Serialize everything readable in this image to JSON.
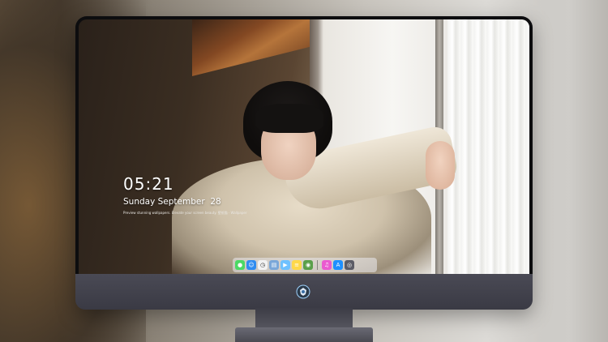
{
  "lockscreen": {
    "time": "05:21",
    "date": "Sunday September  28",
    "tagline": "Preview stunning wallpapers. Elevate your screen beauty. 壁纸猫 · Wallpaper"
  },
  "dock": {
    "icons": [
      {
        "name": "messages-icon",
        "color": "#4cd964",
        "glyph": "●"
      },
      {
        "name": "finder-icon",
        "color": "#2f8cf0",
        "glyph": "☺"
      },
      {
        "name": "clock-icon",
        "color": "#f2f2f2",
        "glyph": "◷"
      },
      {
        "name": "preview-icon",
        "color": "#7aa7d9",
        "glyph": "▤"
      },
      {
        "name": "finalcut-icon",
        "color": "#6ec1ff",
        "glyph": "▶"
      },
      {
        "name": "notes-icon",
        "color": "#ffd84a",
        "glyph": "≡"
      },
      {
        "name": "photobooth-icon",
        "color": "#5a9f4a",
        "glyph": "◉"
      },
      {
        "name": "itunes-icon",
        "color": "#ea5ad0",
        "glyph": "♫"
      },
      {
        "name": "appstore-icon",
        "color": "#1e90ff",
        "glyph": "A"
      },
      {
        "name": "camera-icon",
        "color": "#5c5c66",
        "glyph": "◎"
      }
    ]
  }
}
